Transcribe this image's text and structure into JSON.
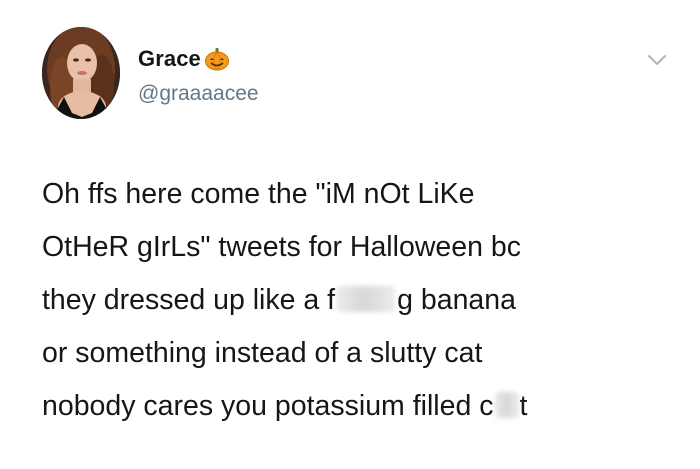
{
  "user": {
    "display_name": "Grace",
    "handle": "@graaaacee",
    "name_emoji": "pumpkin-icon",
    "avatar": "avatar"
  },
  "menu": {
    "icon": "chevron-down-icon"
  },
  "tweet": {
    "line1": "Oh ffs here come the \"iM nOt LiKe",
    "line2": "OtHeR gIrLs\" tweets for Halloween bc",
    "line3_start": "they dressed up like a f",
    "line3_end": "g banana",
    "line4": "or something instead of a slutty cat",
    "line5_start": "nobody cares you potassium filled c",
    "line5_end": "t"
  },
  "colors": {
    "text": "#14171a",
    "secondary": "#657786",
    "pumpkin": "#f59a1c"
  }
}
